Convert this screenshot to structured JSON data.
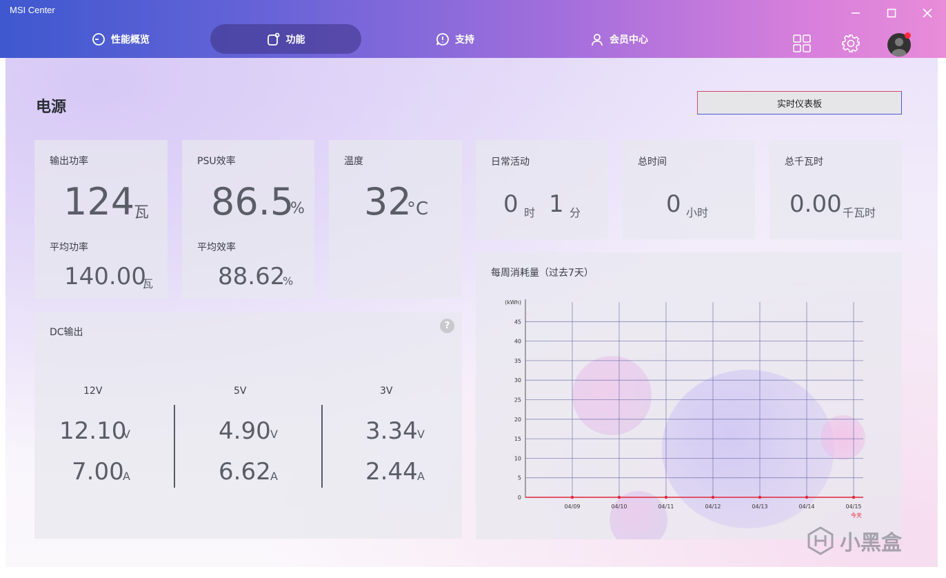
{
  "app": {
    "title": "MSI Center"
  },
  "nav": {
    "tabs": [
      {
        "label": "性能概览",
        "icon": "gauge-icon"
      },
      {
        "label": "功能",
        "icon": "feature-icon",
        "active": true
      },
      {
        "label": "支持",
        "icon": "chat-icon"
      },
      {
        "label": "会员中心",
        "icon": "user-icon"
      }
    ]
  },
  "page": {
    "title": "电源",
    "dashboard_button": "实时仪表板"
  },
  "output_power": {
    "label": "输出功率",
    "value": "124",
    "unit": "瓦",
    "avg_label": "平均功率",
    "avg_value": "140.00",
    "avg_unit": "瓦"
  },
  "psu_efficiency": {
    "label": "PSU效率",
    "value": "86.5",
    "unit": "%",
    "avg_label": "平均效率",
    "avg_value": "88.62",
    "avg_unit": "%"
  },
  "temperature": {
    "label": "温度",
    "value": "32",
    "unit": "°C"
  },
  "daily_activity": {
    "label": "日常活动",
    "hours": "0",
    "hours_unit": "时",
    "minutes": "1",
    "minutes_unit": "分"
  },
  "total_time": {
    "label": "总时间",
    "value": "0",
    "unit": "小时"
  },
  "total_kwh": {
    "label": "总千瓦时",
    "value": "0.00",
    "unit": "千瓦时"
  },
  "dc_output": {
    "label": "DC输出",
    "help": "?",
    "rails": [
      {
        "name": "12V",
        "volt": "12.10",
        "volt_unit": "V",
        "amp": "7.00",
        "amp_unit": "A"
      },
      {
        "name": "5V",
        "volt": "4.90",
        "volt_unit": "V",
        "amp": "6.62",
        "amp_unit": "A"
      },
      {
        "name": "3V",
        "volt": "3.34",
        "volt_unit": "V",
        "amp": "2.44",
        "amp_unit": "A"
      }
    ]
  },
  "weekly": {
    "label": "每周消耗量（过去7天）"
  },
  "chart_data": {
    "type": "line",
    "ylabel": "(kWh)",
    "categories": [
      "04/09",
      "04/10",
      "04/11",
      "04/12",
      "04/13",
      "04/14",
      "04/15"
    ],
    "today_label": "今天",
    "series": [
      {
        "values": [
          0,
          0,
          0,
          0,
          0,
          0,
          0
        ]
      }
    ],
    "ylim": [
      0,
      50
    ],
    "yticks": [
      0,
      5,
      10,
      15,
      20,
      25,
      30,
      35,
      40,
      45
    ],
    "grid": true,
    "colors": {
      "line": "#e0263a",
      "grid": "#6a6ea8"
    }
  },
  "watermark": "小黑盒"
}
